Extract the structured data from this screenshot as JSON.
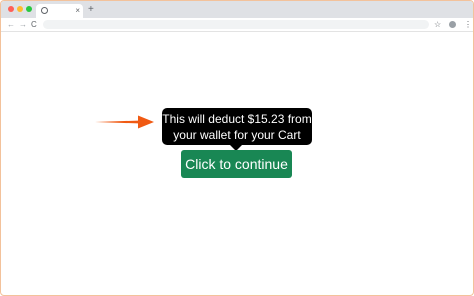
{
  "browser": {
    "window_controls": [
      "close",
      "minimize",
      "maximize"
    ],
    "tab": {
      "favicon": "globe-icon",
      "close_label": "×"
    },
    "new_tab_label": "+",
    "toolbar": {
      "back_icon": "←",
      "forward_icon": "→",
      "reload_icon": "C",
      "bookmark_icon": "☆",
      "menu_icon": "⋮"
    }
  },
  "page": {
    "tooltip": {
      "line1": "This will deduct $15.23 from",
      "line2": "your wallet for your Cart"
    },
    "button_label": "Click to continue",
    "colors": {
      "button": "#198754",
      "tooltip_bg": "#000000",
      "arrow": "#f05a13"
    }
  }
}
